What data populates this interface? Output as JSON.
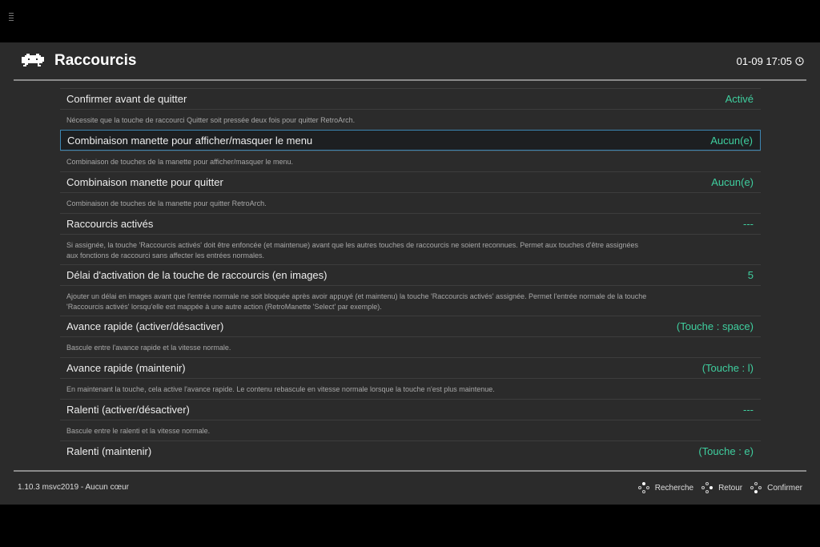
{
  "header": {
    "title": "Raccourcis",
    "clock": "01-09 17:05",
    "clock_icon": "clock-icon",
    "logo_icon": "retroarch-invader-logo"
  },
  "accent": "#3fcf9f",
  "items": [
    {
      "label": "Confirmer avant de quitter",
      "value": "Activé",
      "desc": "Nécessite que la touche de raccourci Quitter soit pressée deux fois pour quitter RetroArch.",
      "lines": 1
    },
    {
      "label": "Combinaison manette pour afficher/masquer le menu",
      "value": "Aucun(e)",
      "desc": "Combinaison de touches de la manette pour afficher/masquer le menu.",
      "lines": 1,
      "selected": true
    },
    {
      "label": "Combinaison manette pour quitter",
      "value": "Aucun(e)",
      "desc": "Combinaison de touches de la manette pour quitter RetroArch.",
      "lines": 1
    },
    {
      "label": "Raccourcis activés",
      "value": "---",
      "desc": "Si assignée, la touche 'Raccourcis activés' doit être enfoncée (et maintenue) avant que les autres touches de raccourcis ne soient reconnues. Permet aux touches d'être assignées aux fonctions de raccourci sans affecter les entrées normales.",
      "lines": 2
    },
    {
      "label": "Délai d'activation de la touche de raccourcis (en images)",
      "value": "5",
      "desc": "Ajouter un délai en images avant que l'entrée normale ne soit bloquée après avoir appuyé (et maintenu) la touche 'Raccourcis activés' assignée. Permet l'entrée normale de la touche 'Raccourcis activés' lorsqu'elle est mappée à une autre action (RetroManette 'Select' par exemple).",
      "lines": 2
    },
    {
      "label": "Avance rapide (activer/désactiver)",
      "value": "(Touche : space)",
      "desc": "Bascule entre l'avance rapide et la vitesse normale.",
      "lines": 1
    },
    {
      "label": "Avance rapide (maintenir)",
      "value": "(Touche : l)",
      "desc": "En maintenant la touche, cela active l'avance rapide. Le contenu rebascule en vitesse normale lorsque la touche n'est plus maintenue.",
      "lines": 1
    },
    {
      "label": "Ralenti (activer/désactiver)",
      "value": "---",
      "desc": "Bascule entre le ralenti et la vitesse normale.",
      "lines": 1
    },
    {
      "label": "Ralenti (maintenir)",
      "value": "(Touche : e)",
      "desc": "",
      "lines": 0
    }
  ],
  "footer": {
    "version": "1.10.3 msvc2019 - Aucun cœur",
    "buttons": [
      {
        "label": "Recherche",
        "icon": "gamepad-top-button-icon",
        "on": "t"
      },
      {
        "label": "Retour",
        "icon": "gamepad-right-button-icon",
        "on": "r"
      },
      {
        "label": "Confirmer",
        "icon": "gamepad-bottom-button-icon",
        "on": "b"
      }
    ]
  }
}
